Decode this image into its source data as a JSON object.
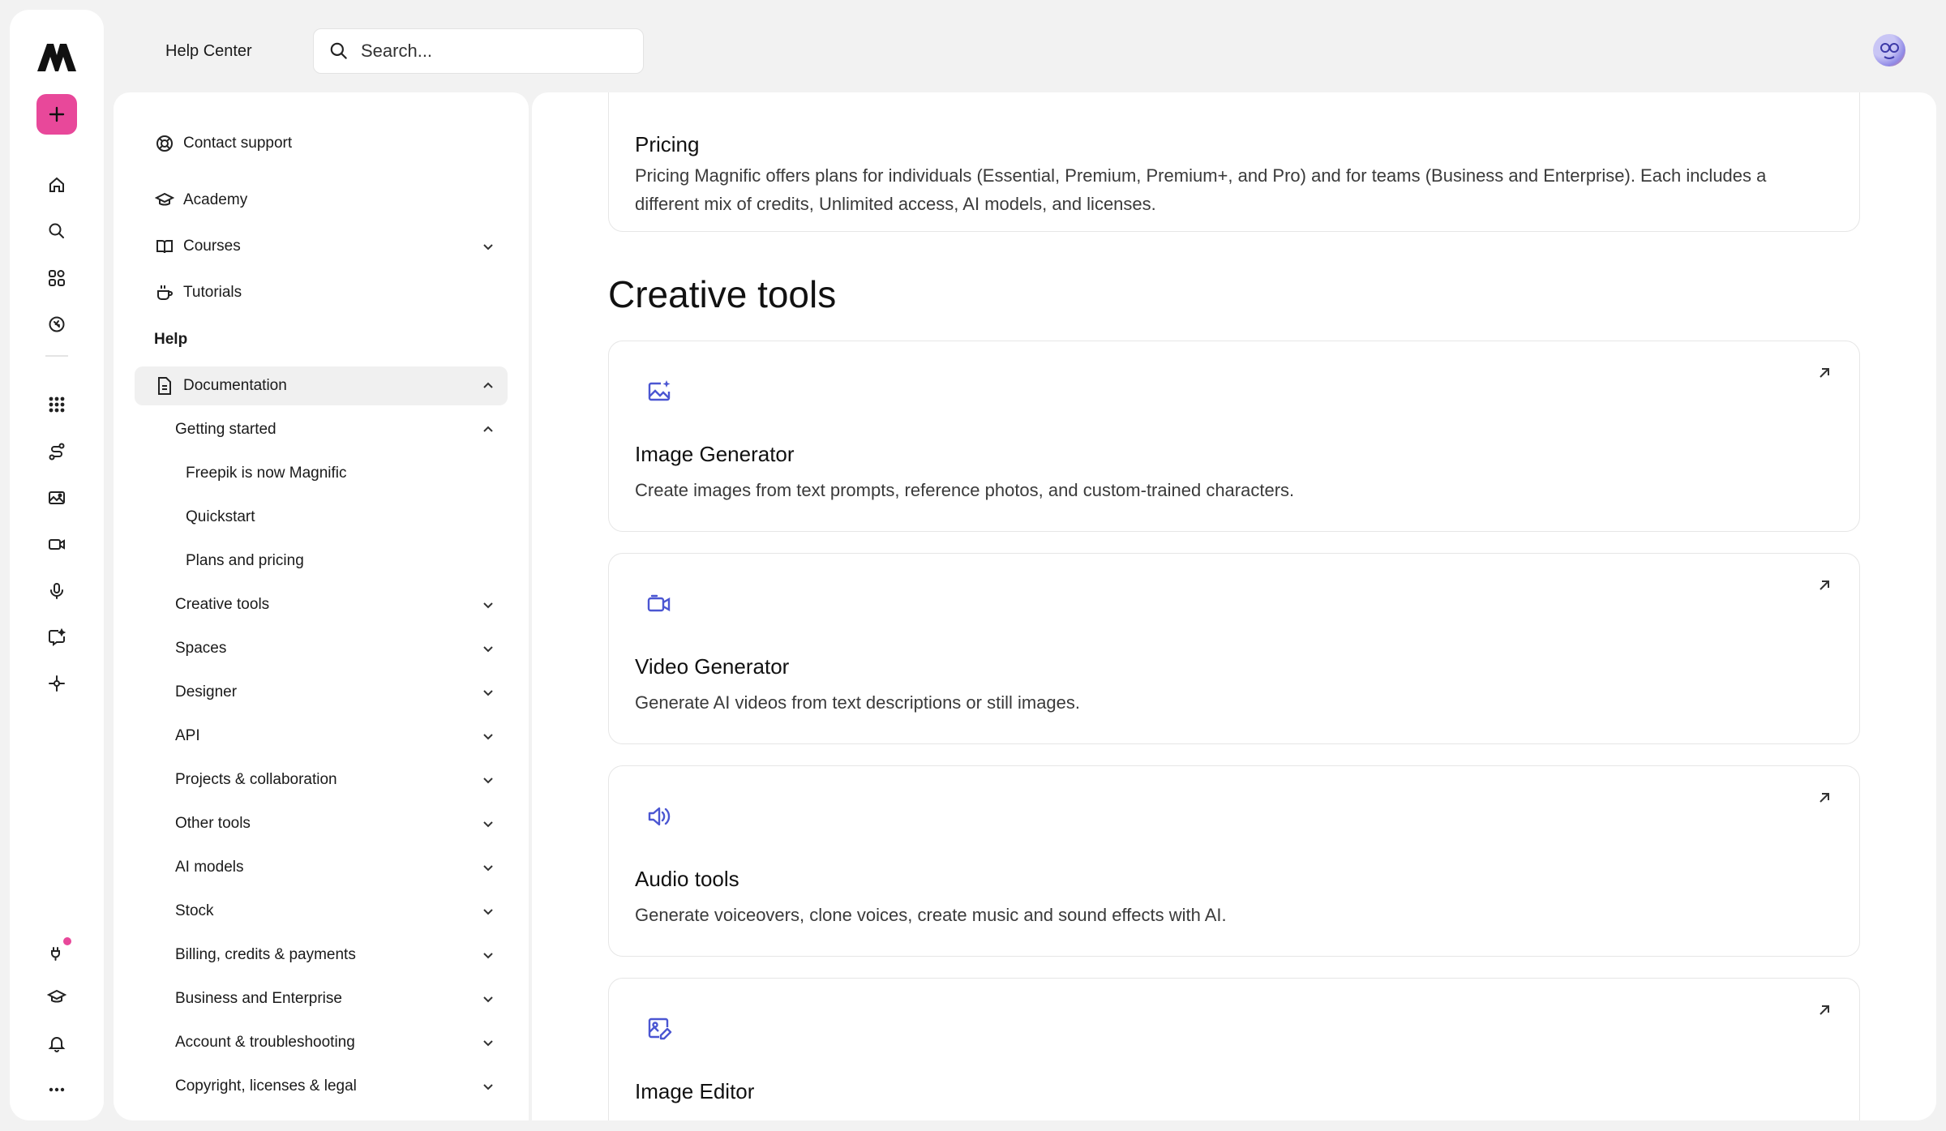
{
  "app": {
    "brand": "Help Center"
  },
  "search": {
    "placeholder": "Search..."
  },
  "rail": {
    "icons": [
      "logo-icon",
      "create-icon",
      "home-icon",
      "search-icon",
      "apps-grid-icon",
      "discover-icon",
      "all-tools-icon",
      "workflow-icon",
      "image-icon",
      "video-icon",
      "microphone-icon",
      "edit-icon",
      "nodes-icon",
      "plugin-icon",
      "academy-icon",
      "bell-icon",
      "more-icon"
    ]
  },
  "sidebar": {
    "top_links": [
      {
        "label": "Contact support",
        "icon": "lifebuoy-icon"
      },
      {
        "label": "Academy",
        "icon": "graduation-cap-icon"
      },
      {
        "label": "Courses",
        "icon": "book-icon"
      },
      {
        "label": "Tutorials",
        "icon": "cup-icon"
      }
    ],
    "help_label": "Help",
    "documentation": "Documentation",
    "getting_started": "Getting started",
    "getting_started_items": [
      "Freepik is now Magnific",
      "Quickstart",
      "Plans and pricing"
    ],
    "sections": [
      "Creative tools",
      "Spaces",
      "Designer",
      "API",
      "Projects & collaboration",
      "Other tools",
      "AI models",
      "Stock",
      "Billing, credits & payments",
      "Business and Enterprise",
      "Account & troubleshooting",
      "Copyright, licenses & legal"
    ]
  },
  "content": {
    "pricing": {
      "title": "Pricing",
      "desc": "Pricing Magnific offers plans for individuals (Essential, Premium, Premium+, and Pro) and for teams (Business and Enterprise). Each includes a different mix of credits, Unlimited access, AI models, and licenses."
    },
    "heading": "Creative tools",
    "cards": [
      {
        "title": "Image Generator",
        "desc": "Create images from text prompts, reference photos, and custom-trained characters.",
        "icon": "image-sparkle-icon"
      },
      {
        "title": "Video Generator",
        "desc": "Generate AI videos from text descriptions or still images.",
        "icon": "video-camera-icon"
      },
      {
        "title": "Audio tools",
        "desc": "Generate voiceovers, clone voices, create music and sound effects with AI.",
        "icon": "speaker-icon"
      },
      {
        "title": "Image Editor",
        "desc": "",
        "icon": "image-edit-icon"
      }
    ]
  },
  "colors": {
    "accent": "#e8489a",
    "icon_blue": "#4b56d2",
    "background": "#f2f2f2"
  }
}
